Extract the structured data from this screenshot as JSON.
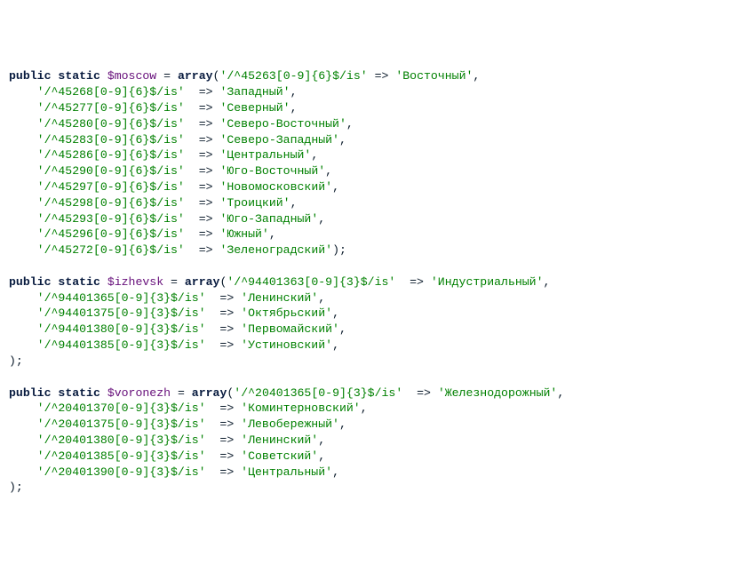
{
  "kw": {
    "public": "public",
    "static": "static"
  },
  "arrow": "=>",
  "paren_open": "(",
  "paren_close": ")",
  "comma": ",",
  "eq": " = ",
  "semi": ";",
  "array": "array",
  "close_seq": ");",
  "moscow": {
    "var": "$moscow",
    "rows": [
      {
        "k": "'/^45263[0-9]{6}$/is'",
        "v": "'Восточный'"
      },
      {
        "k": "'/^45268[0-9]{6}$/is'",
        "v": "'Западный'"
      },
      {
        "k": "'/^45277[0-9]{6}$/is'",
        "v": "'Северный'"
      },
      {
        "k": "'/^45280[0-9]{6}$/is'",
        "v": "'Северо-Восточный'"
      },
      {
        "k": "'/^45283[0-9]{6}$/is'",
        "v": "'Северо-Западный'"
      },
      {
        "k": "'/^45286[0-9]{6}$/is'",
        "v": "'Центральный'"
      },
      {
        "k": "'/^45290[0-9]{6}$/is'",
        "v": "'Юго-Восточный'"
      },
      {
        "k": "'/^45297[0-9]{6}$/is'",
        "v": "'Новомосковский'"
      },
      {
        "k": "'/^45298[0-9]{6}$/is'",
        "v": "'Троицкий'"
      },
      {
        "k": "'/^45293[0-9]{6}$/is'",
        "v": "'Юго-Западный'"
      },
      {
        "k": "'/^45296[0-9]{6}$/is'",
        "v": "'Южный'"
      },
      {
        "k": "'/^45272[0-9]{6}$/is'",
        "v": "'Зеленоградский'"
      }
    ]
  },
  "izhevsk": {
    "var": "$izhevsk",
    "rows": [
      {
        "k": "'/^94401363[0-9]{3}$/is'",
        "v": "'Индустриальный'"
      },
      {
        "k": "'/^94401365[0-9]{3}$/is'",
        "v": "'Ленинский'"
      },
      {
        "k": "'/^94401375[0-9]{3}$/is'",
        "v": "'Октябрьский'"
      },
      {
        "k": "'/^94401380[0-9]{3}$/is'",
        "v": "'Первомайский'"
      },
      {
        "k": "'/^94401385[0-9]{3}$/is'",
        "v": "'Устиновский'"
      }
    ]
  },
  "voronezh": {
    "var": "$voronezh",
    "rows": [
      {
        "k": "'/^20401365[0-9]{3}$/is'",
        "v": "'Железнодорожный'"
      },
      {
        "k": "'/^20401370[0-9]{3}$/is'",
        "v": "'Коминтерновский'"
      },
      {
        "k": "'/^20401375[0-9]{3}$/is'",
        "v": "'Левобережный'"
      },
      {
        "k": "'/^20401380[0-9]{3}$/is'",
        "v": "'Ленинский'"
      },
      {
        "k": "'/^20401385[0-9]{3}$/is'",
        "v": "'Советский'"
      },
      {
        "k": "'/^20401390[0-9]{3}$/is'",
        "v": "'Центральный'"
      }
    ]
  }
}
